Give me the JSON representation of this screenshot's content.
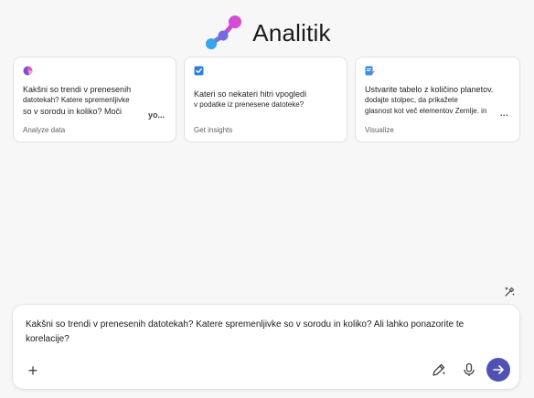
{
  "app": {
    "title": "Analitik",
    "logo_icon": "analyst-molecule-icon"
  },
  "suggestions": [
    {
      "icon": "chart-pie-icon",
      "text_line1": "Kakšni so trendi v prenesenih",
      "text_line2": "datotekah? Katere spremenljivke",
      "text_line3": "so v sorodu in koliko? Moči",
      "trail": "yo...",
      "category": "Analyze data"
    },
    {
      "icon": "checkbox-icon",
      "text_line1": "Kateri so nekateri hitri vpogledi",
      "text_line2": "v podatke iz prenesene datoteke?",
      "category": "Get insights"
    },
    {
      "icon": "edit-document-icon",
      "text_line1": "Ustvarite tabelo z količino planetov.",
      "text_line2": "dodajte stolpec, da prikažete",
      "text_line3": "glasnost kot več elementov Zemlje. in",
      "more": "...",
      "category": "Visualize"
    }
  ],
  "composer": {
    "text": "Kakšni so trendi v prenesenih datotekah? Katere spremenljivke so v sorodu in koliko? Ali lahko ponazorite te korelacije?",
    "add_label": "+"
  },
  "colors": {
    "accent": "#4f52b2",
    "background": "#f7f7f8",
    "card_border": "#e1e1e3"
  }
}
